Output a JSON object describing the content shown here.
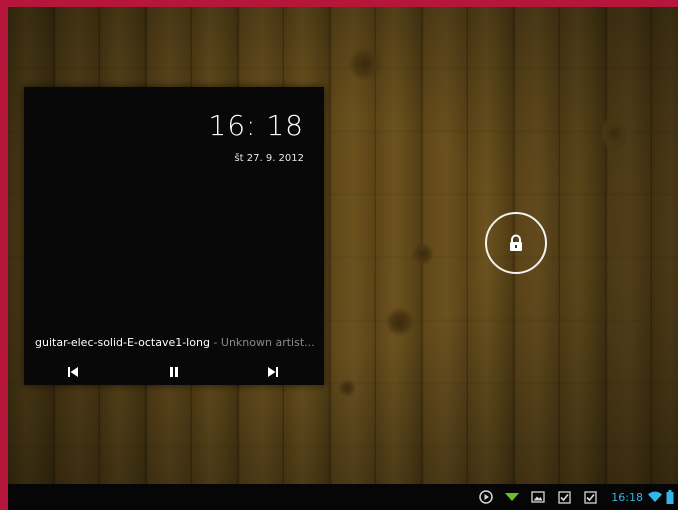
{
  "lockscreen": {
    "clock": "16: 18",
    "date": "št 27. 9. 2012",
    "lock_icon": "lock-icon"
  },
  "music": {
    "track_title": "guitar-elec-solid-E-octave1-long",
    "artist": " - Unknown artist...",
    "controls": [
      "previous-icon",
      "pause-icon",
      "next-icon"
    ]
  },
  "status_bar": {
    "time": "16:18",
    "icons": [
      "play-icon",
      "download-icon",
      "image-icon",
      "checkbox-icon",
      "checkbox-icon",
      "wifi-icon",
      "battery-icon"
    ],
    "accent": "#33b5e5"
  },
  "colors": {
    "frame": "#b5163a",
    "widget_bg": "#080808"
  }
}
